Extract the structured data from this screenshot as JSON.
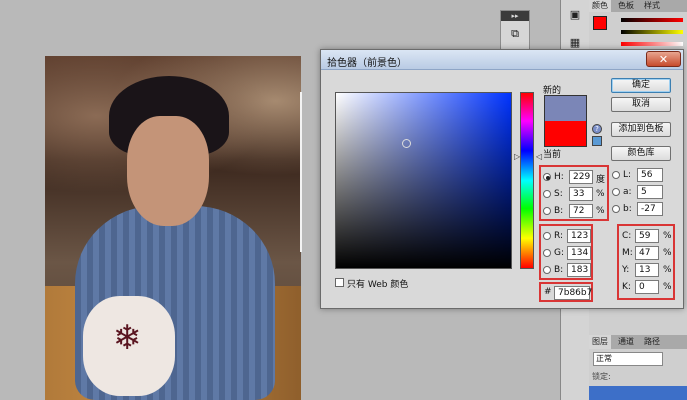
{
  "dialog": {
    "title": "拾色器（前景色）",
    "close_glyph": "✕",
    "new_label": "新的",
    "current_label": "当前",
    "buttons": {
      "ok": "确定",
      "cancel": "取消",
      "add_swatch": "添加到色板",
      "color_lib": "颜色库"
    },
    "web_only_label": "只有 Web 颜色",
    "new_color": "#7b86b7",
    "current_color": "#ff0000",
    "hsb": [
      {
        "key": "H:",
        "value": "229",
        "unit": "度",
        "selected": true
      },
      {
        "key": "S:",
        "value": "33",
        "unit": "%",
        "selected": false
      },
      {
        "key": "B:",
        "value": "72",
        "unit": "%",
        "selected": false
      }
    ],
    "lab": [
      {
        "key": "L:",
        "value": "56"
      },
      {
        "key": "a:",
        "value": "5"
      },
      {
        "key": "b:",
        "value": "-27"
      }
    ],
    "rgb": [
      {
        "key": "R:",
        "value": "123"
      },
      {
        "key": "G:",
        "value": "134"
      },
      {
        "key": "B:",
        "value": "183"
      }
    ],
    "cmyk": [
      {
        "key": "C:",
        "value": "59",
        "unit": "%"
      },
      {
        "key": "M:",
        "value": "47",
        "unit": "%"
      },
      {
        "key": "Y:",
        "value": "13",
        "unit": "%"
      },
      {
        "key": "K:",
        "value": "0",
        "unit": "%"
      }
    ],
    "hex_label": "#",
    "hex": "7b86b7"
  },
  "right_panel": {
    "tabs": [
      "颜色",
      "色板",
      "样式"
    ],
    "fg_color": "#ff0000",
    "bg_color": "#f4e1b8",
    "layers_tabs": [
      "图层",
      "通道",
      "路径"
    ],
    "blend_mode": "正常",
    "lock_label": "锁定:"
  },
  "icons": {
    "mini_panel": "history-icon",
    "dock": [
      "color-icon",
      "swatch-icon",
      "adjust-icon",
      "brush-icon"
    ]
  }
}
